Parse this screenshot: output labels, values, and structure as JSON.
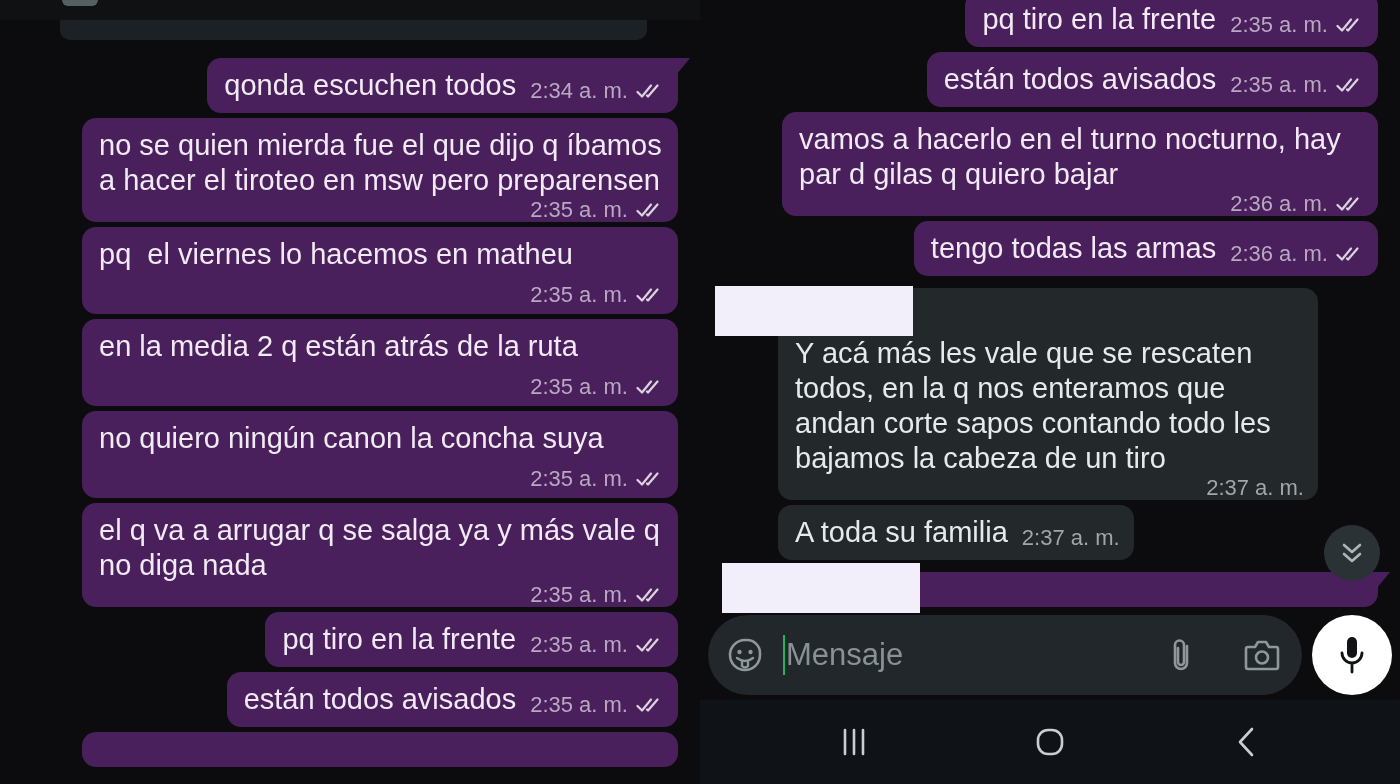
{
  "left_screen": {
    "messages": [
      {
        "kind": "outgoing",
        "text": "qonda escuchen todos",
        "time": "2:34 a. m.",
        "delivered": true,
        "tail": true,
        "redacted": false
      },
      {
        "kind": "outgoing",
        "text": "no se quien mierda fue el que dijo q íbamos a hacer el tiroteo en msw pero preparensen",
        "time": "2:35 a. m.",
        "delivered": true,
        "tail": false,
        "redacted": false
      },
      {
        "kind": "outgoing",
        "text": "pq  el viernes lo hacemos en matheu",
        "time": "2:35 a. m.",
        "delivered": true,
        "tail": false,
        "redacted": false
      },
      {
        "kind": "outgoing",
        "text": "en la media 2 q están atrás de la ruta",
        "time": "2:35 a. m.",
        "delivered": true,
        "tail": false,
        "redacted": false
      },
      {
        "kind": "outgoing",
        "text": "no quiero ningún canon la concha suya",
        "time": "2:35 a. m.",
        "delivered": true,
        "tail": false,
        "redacted": false
      },
      {
        "kind": "outgoing",
        "text": "el q va a arrugar q se salga ya y más vale q no diga nada",
        "time": "2:35 a. m.",
        "delivered": true,
        "tail": false,
        "redacted": false
      },
      {
        "kind": "outgoing",
        "text": "pq tiro en la frente",
        "time": "2:35 a. m.",
        "delivered": true,
        "tail": false,
        "redacted": false
      },
      {
        "kind": "outgoing",
        "text": "están todos avisados",
        "time": "2:35 a. m.",
        "delivered": true,
        "tail": false,
        "redacted": false
      },
      {
        "kind": "outgoing",
        "tail": false,
        "redacted": false
      }
    ]
  },
  "right_screen": {
    "messages": [
      {
        "kind": "outgoing",
        "text": "pq tiro en la frente",
        "time": "2:35 a. m.",
        "delivered": true,
        "tail": false,
        "redacted": false
      },
      {
        "kind": "outgoing",
        "text": "están todos avisados",
        "time": "2:35 a. m.",
        "delivered": true,
        "tail": false,
        "redacted": false
      },
      {
        "kind": "outgoing",
        "text": "vamos a hacerlo en el turno nocturno, hay par d gilas q quiero bajar",
        "time": "2:36 a. m.",
        "delivered": true,
        "tail": false,
        "redacted": false
      },
      {
        "kind": "outgoing",
        "text": "tengo todas las armas",
        "time": "2:36 a. m.",
        "delivered": true,
        "tail": false,
        "redacted": false
      },
      {
        "kind": "incoming",
        "text": "Y acá más les vale que se rescaten todos, en la q nos enteramos que andan corte sapos contando todo les bajamos la cabeza de un tiro",
        "time": "2:37 a. m.",
        "tail": false,
        "redacted": true
      },
      {
        "kind": "incoming",
        "text": "A toda su familia",
        "time": "2:37 a. m.",
        "tail": false,
        "redacted": false
      },
      {
        "kind": "outgoing",
        "tail": true,
        "redacted": true
      }
    ],
    "composer": {
      "placeholder": "Mensaje"
    }
  }
}
